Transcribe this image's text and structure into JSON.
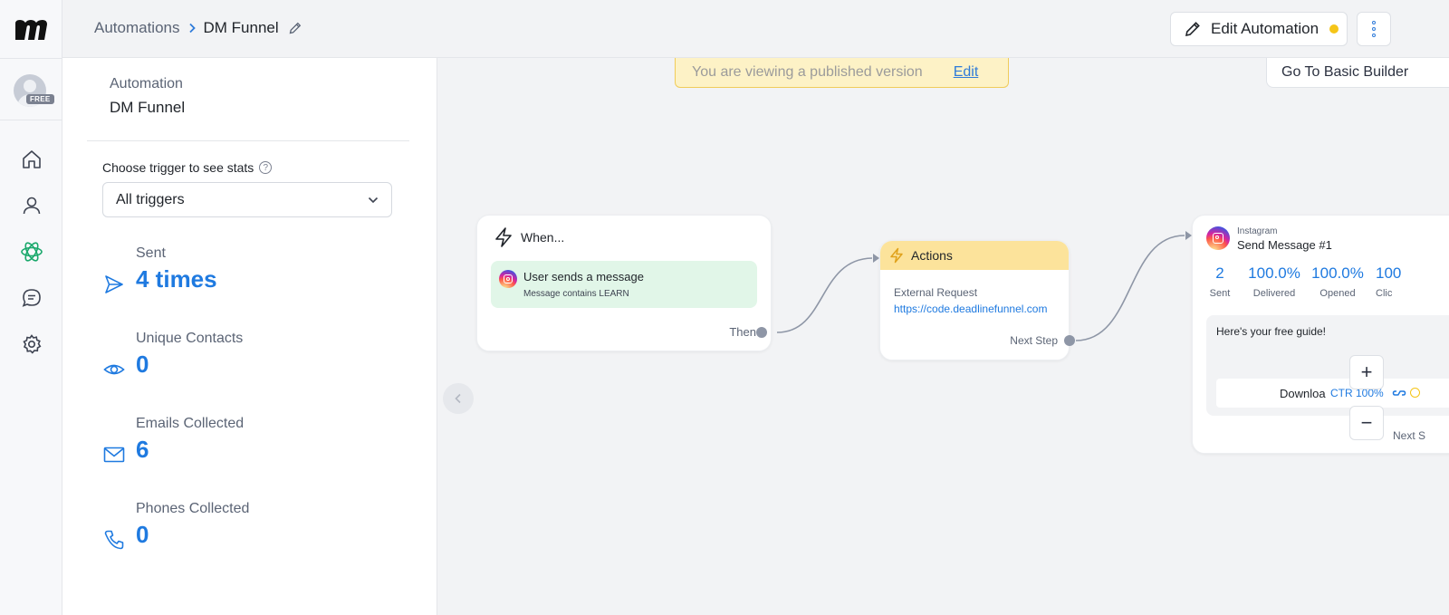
{
  "header": {
    "breadcrumb_root": "Automations",
    "breadcrumb_current": "DM Funnel",
    "edit_automation_label": "Edit Automation"
  },
  "rail": {
    "badge": "FREE"
  },
  "panel": {
    "automation_label": "Automation",
    "automation_name": "DM Funnel",
    "choose_trigger_label": "Choose trigger to see stats",
    "trigger_select_value": "All triggers",
    "stats": [
      {
        "label": "Sent",
        "value": "4 times",
        "icon": "send-icon"
      },
      {
        "label": "Unique Contacts",
        "value": "0",
        "icon": "eye-icon"
      },
      {
        "label": "Emails Collected",
        "value": "6",
        "icon": "mail-icon"
      },
      {
        "label": "Phones Collected",
        "value": "0",
        "icon": "phone-icon"
      }
    ]
  },
  "canvas": {
    "banner_text": "You are viewing a published version",
    "banner_edit": "Edit",
    "basic_builder_label": "Go To Basic Builder",
    "when_node": {
      "title": "When...",
      "trigger_title": "User sends a message",
      "trigger_sub": "Message contains LEARN",
      "then_label": "Then"
    },
    "actions_node": {
      "title": "Actions",
      "item_label": "External Request",
      "item_url": "https://code.deadlinefunnel.com",
      "next_label": "Next Step"
    },
    "message_node": {
      "channel": "Instagram",
      "title": "Send Message #1",
      "stats": [
        {
          "value": "2",
          "label": "Sent"
        },
        {
          "value": "100.0%",
          "label": "Delivered"
        },
        {
          "value": "100.0%",
          "label": "Opened"
        },
        {
          "value": "100",
          "label": "Clic"
        }
      ],
      "text": "Here's your free guide!",
      "button_text": "Downloa",
      "ctr": "CTR 100%",
      "next_label": "Next S"
    },
    "zoom_in": "+",
    "zoom_out": "−"
  },
  "colors": {
    "accent": "#1f7ae0",
    "banner_bg": "#fdf2c6",
    "trigger_bg": "#e1f6e8",
    "actions_head_bg": "#fce39b",
    "status_dot": "#f5c518"
  }
}
